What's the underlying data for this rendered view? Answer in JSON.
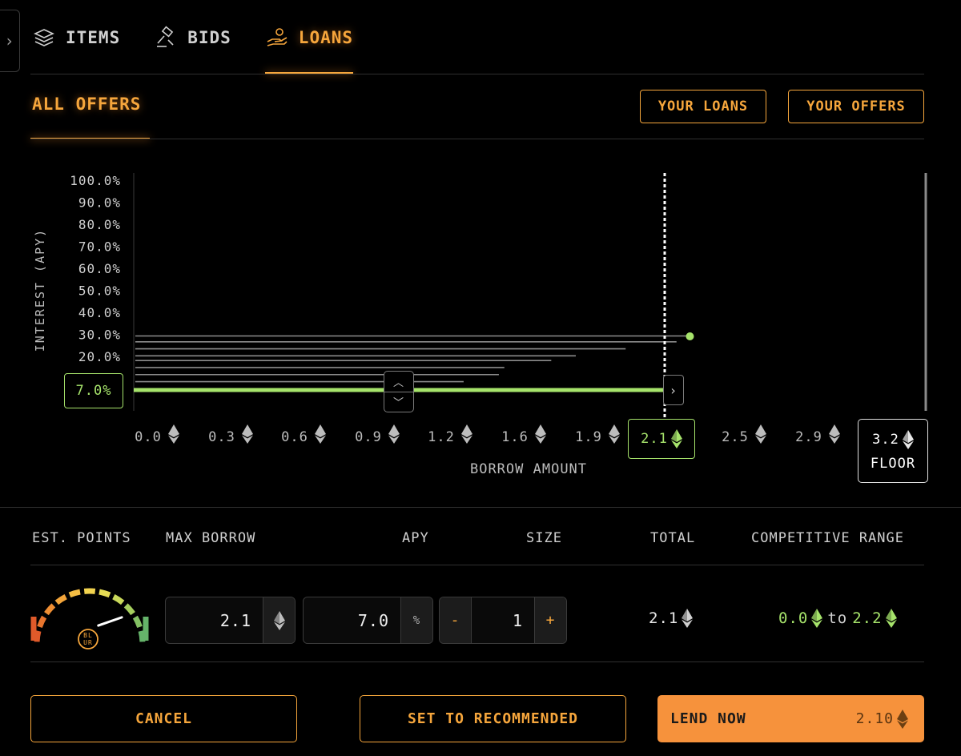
{
  "tabs": [
    {
      "label": "ITEMS",
      "icon": "layers-icon",
      "active": false
    },
    {
      "label": "BIDS",
      "icon": "gavel-icon",
      "active": false
    },
    {
      "label": "LOANS",
      "icon": "hand-coin-icon",
      "active": true
    }
  ],
  "subheader": {
    "title": "ALL OFFERS",
    "your_loans_label": "YOUR LOANS",
    "your_offers_label": "YOUR OFFERS"
  },
  "chart_data": {
    "type": "bar",
    "orientation": "horizontal",
    "title": "",
    "xlabel": "BORROW AMOUNT",
    "ylabel": "INTEREST (APY)",
    "y_ticks": [
      "100.0%",
      "90.0%",
      "80.0%",
      "70.0%",
      "60.0%",
      "50.0%",
      "40.0%",
      "30.0%",
      "20.0%"
    ],
    "x_ticks": [
      "0.0",
      "0.3",
      "0.6",
      "0.9",
      "1.2",
      "1.6",
      "1.9",
      "2.5",
      "2.9"
    ],
    "ylim": [
      0,
      100
    ],
    "offers": [
      {
        "apy": 33.5,
        "amount": 2.2
      },
      {
        "apy": 31.0,
        "amount": 2.15
      },
      {
        "apy": 28.0,
        "amount": 1.95
      },
      {
        "apy": 25.0,
        "amount": 1.75
      },
      {
        "apy": 23.0,
        "amount": 1.65
      },
      {
        "apy": 20.0,
        "amount": 1.41
      },
      {
        "apy": 17.0,
        "amount": 1.38
      },
      {
        "apy": 14.0,
        "amount": 1.19
      }
    ],
    "selected_apy_label": "7.0%",
    "selected_amount_label": "2.1",
    "floor_value": "3.2",
    "floor_label": "FLOOR",
    "accent_color": "#a6e36b"
  },
  "stats": {
    "headers": {
      "est_points": "EST. POINTS",
      "max_borrow": "MAX BORROW",
      "apy": "APY",
      "size": "SIZE",
      "total": "TOTAL",
      "competitive_range": "COMPETITIVE RANGE"
    },
    "gauge_level": 0.78,
    "gauge_badge": "BL UR",
    "max_borrow_value": "2.1",
    "apy_value": "7.0",
    "apy_unit": "%",
    "size_value": "1",
    "size_minus": "-",
    "size_plus": "+",
    "total_value": "2.1",
    "range_from": "0.0",
    "range_to_word": "to",
    "range_to": "2.2"
  },
  "actions": {
    "cancel_label": "CANCEL",
    "recommended_label": "SET TO RECOMMENDED",
    "lend_label": "LEND NOW",
    "lend_amount": "2.10"
  },
  "colors": {
    "accent_orange": "#f6a63c",
    "accent_green": "#a6e36b",
    "background": "#000000"
  }
}
